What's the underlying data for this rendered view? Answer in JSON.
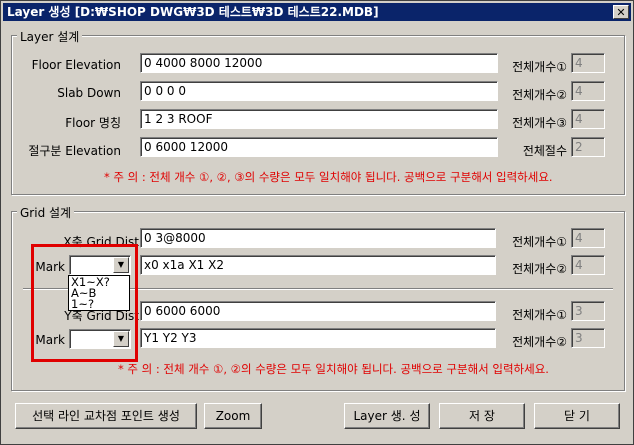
{
  "window": {
    "title": "Layer 생성    [D:₩SHOP DWG₩3D 테스트₩3D 테스트22.MDB]",
    "close_glyph": "✕"
  },
  "layer_group": {
    "title": "Layer 설계",
    "rows": [
      {
        "label": "Floor Elevation",
        "value": "0 4000 8000 12000",
        "count_label": "전체개수①",
        "count": "4"
      },
      {
        "label": "Slab Down",
        "value": "0 0 0 0",
        "count_label": "전체개수②",
        "count": "4"
      },
      {
        "label": "Floor 명칭",
        "value": "1 2 3 ROOF",
        "count_label": "전체개수③",
        "count": "4"
      },
      {
        "label": "절구분 Elevation",
        "value": "0 6000 12000",
        "count_label": "전체절수",
        "count": "2"
      }
    ],
    "note": "* 주 의 : 전체 개수 ①, ②, ③의 수량은 모두 일치해야 됩니다. 공백으로 구분해서 입력하세요."
  },
  "grid_group": {
    "title": "Grid 설계",
    "x_dist": {
      "label": "X축 Grid Dist",
      "value": "0 3@8000",
      "count_label": "전체개수①",
      "count": "4"
    },
    "x_mark": {
      "label": "Mark",
      "value": "x0 x1a X1 X2",
      "count_label": "전체개수②",
      "count": "4"
    },
    "y_dist": {
      "label": "Y축 Grid Dist",
      "value": "0 6000 6000",
      "count_label": "전체개수①",
      "count": "3"
    },
    "y_mark": {
      "label": "Mark",
      "value": "Y1 Y2 Y3",
      "count_label": "전체개수②",
      "count": "3"
    },
    "dropdown_options": [
      "X1~X?",
      "A~B",
      "1~?"
    ],
    "note": "* 주 의 : 전체 개수 ①, ②의 수량은 모두 일치해야 됩니다. 공백으로 구분해서 입력하세요."
  },
  "buttons": {
    "create_points": "선택 라인 교차점 포인트 생성",
    "zoom": "Zoom",
    "layer_create": "Layer 생. 성",
    "save": "저   장",
    "close": "닫 기"
  }
}
